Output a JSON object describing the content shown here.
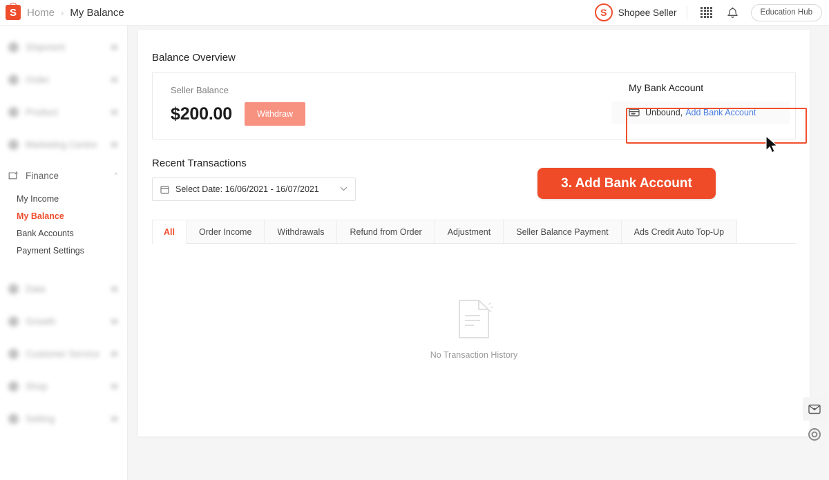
{
  "header": {
    "logo_letter": "S",
    "breadcrumb": {
      "home": "Home",
      "separator": "›",
      "current": "My Balance"
    },
    "seller_logo_letter": "S",
    "seller_name": "Shopee Seller",
    "apps_icon": "grid-apps-icon",
    "bell_icon": "notification-bell-icon",
    "education_hub_label": "Education Hub"
  },
  "sidebar": {
    "groups": [
      {
        "label": "Shipment",
        "icon": "truck-icon",
        "blurred": true,
        "expanded": false
      },
      {
        "label": "Order",
        "icon": "order-icon",
        "blurred": true,
        "expanded": false
      },
      {
        "label": "Product",
        "icon": "product-icon",
        "blurred": true,
        "expanded": false
      },
      {
        "label": "Marketing Centre",
        "icon": "megaphone-icon",
        "blurred": true,
        "expanded": false
      },
      {
        "label": "Finance",
        "icon": "finance-icon",
        "blurred": false,
        "expanded": true
      },
      {
        "label": "Data",
        "icon": "chart-icon",
        "blurred": true,
        "expanded": false
      },
      {
        "label": "Growth",
        "icon": "growth-icon",
        "blurred": true,
        "expanded": false
      },
      {
        "label": "Customer Service",
        "icon": "headset-icon",
        "blurred": true,
        "expanded": false
      },
      {
        "label": "Shop",
        "icon": "shop-icon",
        "blurred": true,
        "expanded": false
      },
      {
        "label": "Setting",
        "icon": "gear-icon",
        "blurred": true,
        "expanded": false
      }
    ],
    "finance_children": [
      {
        "label": "My Income",
        "active": false
      },
      {
        "label": "My Balance",
        "active": true
      },
      {
        "label": "Bank Accounts",
        "active": false
      },
      {
        "label": "Payment Settings",
        "active": false
      }
    ]
  },
  "balance_overview": {
    "title": "Balance Overview",
    "seller_balance_label": "Seller Balance",
    "seller_balance_amount": "$200.00",
    "withdraw_label": "Withdraw",
    "bank_title": "My Bank Account",
    "bank_icon": "bank-card-icon",
    "bank_status": "Unbound,",
    "bank_link": "Add Bank Account"
  },
  "annotation": {
    "callout_label": "3. Add Bank Account",
    "highlight_color": "#f04f2e",
    "callout_bg": "#ef4b28",
    "cursor": "mouse-pointer"
  },
  "recent_transactions": {
    "title": "Recent Transactions",
    "date_picker": {
      "icon": "calendar-icon",
      "value": "Select Date: 16/06/2021 - 16/07/2021",
      "chevron": "⌄"
    },
    "tabs": [
      {
        "label": "All",
        "active": true
      },
      {
        "label": "Order Income",
        "active": false
      },
      {
        "label": "Withdrawals",
        "active": false
      },
      {
        "label": "Refund from Order",
        "active": false
      },
      {
        "label": "Adjustment",
        "active": false
      },
      {
        "label": "Seller Balance Payment",
        "active": false
      },
      {
        "label": "Ads Credit Auto Top-Up",
        "active": false
      }
    ],
    "empty_state": {
      "icon": "document-empty-icon",
      "text": "No Transaction History"
    }
  },
  "floating": {
    "chat_icon": "chat-mail-icon",
    "help_icon": "help-circle-icon"
  },
  "colors": {
    "brand": "#ee4d2d",
    "withdraw_disabled": "#f79180",
    "link_blue": "#4a7fe0",
    "page_bg": "#f5f5f5"
  }
}
